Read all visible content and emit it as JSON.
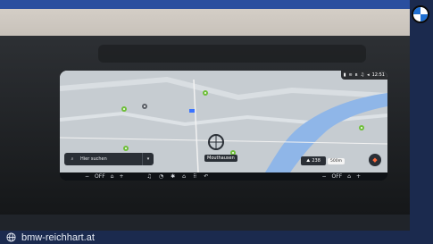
{
  "statusbar": {
    "time": "12:51"
  },
  "map": {
    "search_placeholder": "Hier suchen",
    "poi_label": "Mouthausen",
    "range": "238",
    "scale": "500m"
  },
  "climate": {
    "left": {
      "minus": "−",
      "off": "OFF",
      "plus": "+"
    },
    "right": {
      "minus": "−",
      "off": "OFF",
      "plus": "+"
    }
  },
  "footer": {
    "url": "bmw-reichhart.at"
  },
  "colors": {
    "footer_bg": "#1b2a4e",
    "water": "#8fb6e8",
    "accent": "#ff6b3d"
  },
  "icons": [
    "bmw-logo",
    "home-icon",
    "search-icon",
    "globe-icon",
    "music-icon",
    "fan-icon",
    "seat-heating-icon",
    "navigation-icon"
  ]
}
